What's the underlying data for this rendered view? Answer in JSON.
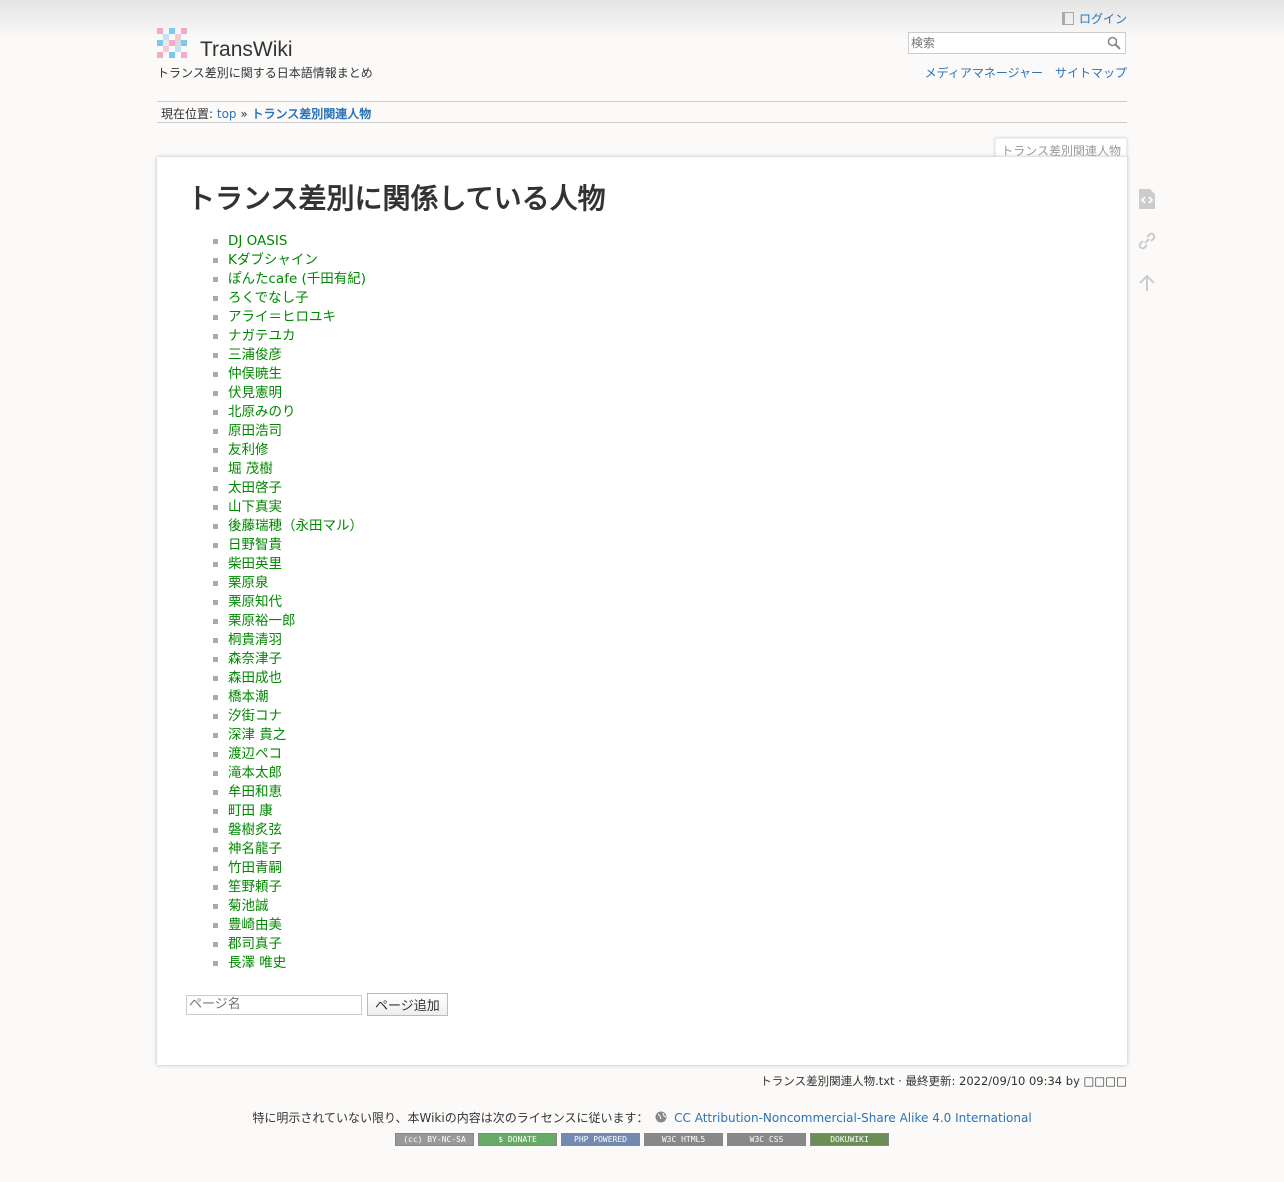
{
  "header": {
    "site_title": "TransWiki",
    "tagline": "トランス差別に関する日本語情報まとめ",
    "login_label": "ログイン",
    "search_placeholder": "検索",
    "media_manager": "メディアマネージャー",
    "sitemap": "サイトマップ"
  },
  "breadcrumb": {
    "prefix": "現在位置:",
    "home": "top",
    "sep": "»",
    "current": "トランス差別関連人物"
  },
  "page": {
    "id_tab": "トランス差別関連人物",
    "title": "トランス差別に関係している人物",
    "items": [
      "DJ OASIS",
      "Kダブシャイン",
      "ぽんたcafe (千田有紀)",
      "ろくでなし子",
      "アライ＝ヒロユキ",
      "ナガテユカ",
      "三浦俊彦",
      "仲俣暁生",
      "伏見憲明",
      "北原みのり",
      "原田浩司",
      "友利修",
      "堀 茂樹",
      "太田啓子",
      "山下真実",
      "後藤瑞穂（永田マル）",
      "日野智貴",
      "柴田英里",
      "栗原泉",
      "栗原知代",
      "栗原裕一郎",
      "桐貴清羽",
      "森奈津子",
      "森田成也",
      "橋本潮",
      "汐街コナ",
      "深津 貴之",
      "渡辺ペコ",
      "滝本太郎",
      "牟田和恵",
      "町田 康",
      "磐樹炙弦",
      "神名龍子",
      "竹田青嗣",
      "笙野頼子",
      "菊池誠",
      "豊崎由美",
      "郡司真子",
      "長澤 唯史"
    ],
    "addpage_placeholder": "ページ名",
    "addpage_button": "ページ追加"
  },
  "footer": {
    "docinfo": "トランス差別関連人物.txt · 最終更新: 2022/09/10 09:34 by □□□□",
    "license_text": "特に明示されていない限り、本Wikiの内容は次のライセンスに従います：",
    "license_link": "CC Attribution-Noncommercial-Share Alike 4.0 International",
    "badges": [
      "(cc) BY-NC-SA",
      "$ DONATE",
      "PHP POWERED",
      "W3C HTML5",
      "W3C CSS",
      "DOKUWIKI"
    ]
  },
  "colors": {
    "link": "#2b73b7",
    "existing_page": "#008800"
  }
}
